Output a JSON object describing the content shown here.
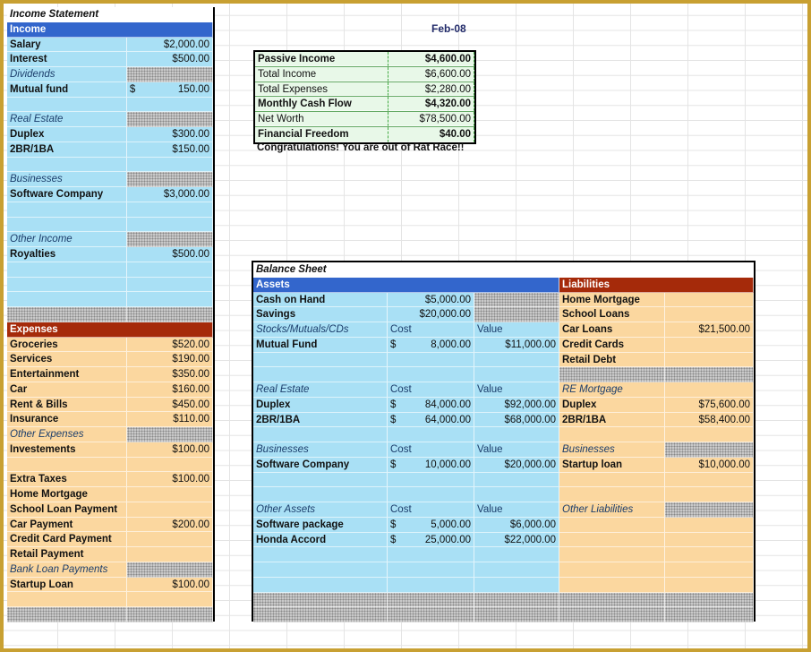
{
  "income_statement": {
    "title": "Income Statement",
    "income_header": "Income",
    "salary": {
      "label": "Salary",
      "value": "$2,000.00"
    },
    "interest": {
      "label": "Interest",
      "value": "$500.00"
    },
    "dividends_label": "Dividends",
    "mutual_fund": {
      "label": "Mutual fund",
      "currency": "$",
      "value": "150.00"
    },
    "real_estate_label": "Real Estate",
    "duplex": {
      "label": "Duplex",
      "value": "$300.00"
    },
    "br": {
      "label": "2BR/1BA",
      "value": "$150.00"
    },
    "businesses_label": "Businesses",
    "software_company": {
      "label": "Software Company",
      "value": "$3,000.00"
    },
    "other_income_label": "Other Income",
    "royalties": {
      "label": "Royalties",
      "value": "$500.00"
    },
    "expenses_header": "Expenses",
    "groceries": {
      "label": "Groceries",
      "value": "$520.00"
    },
    "services": {
      "label": "Services",
      "value": "$190.00"
    },
    "entertainment": {
      "label": "Entertainment",
      "value": "$350.00"
    },
    "car": {
      "label": "Car",
      "value": "$160.00"
    },
    "rent": {
      "label": "Rent & Bills",
      "value": "$450.00"
    },
    "insurance": {
      "label": "Insurance",
      "value": "$110.00"
    },
    "other_expenses_label": "Other Expenses",
    "investements": {
      "label": "Investements",
      "value": "$100.00"
    },
    "extra_taxes": {
      "label": "Extra Taxes",
      "value": "$100.00"
    },
    "home_mortgage": {
      "label": "Home Mortgage",
      "value": ""
    },
    "school_loan": {
      "label": "School Loan Payment",
      "value": ""
    },
    "car_payment": {
      "label": "Car Payment",
      "value": "$200.00"
    },
    "credit_card": {
      "label": "Credit Card Payment",
      "value": ""
    },
    "retail": {
      "label": "Retail Payment",
      "value": ""
    },
    "bank_loan_label": "Bank Loan Payments",
    "startup_loan": {
      "label": "Startup Loan",
      "value": "$100.00"
    }
  },
  "month": "Feb-08",
  "summary": {
    "passive_income": {
      "label": "Passive Income",
      "value": "$4,600.00"
    },
    "total_income": {
      "label": "Total Income",
      "value": "$6,600.00"
    },
    "total_expenses": {
      "label": "Total Expenses",
      "value": "$2,280.00"
    },
    "monthly_cash_flow": {
      "label": "Monthly Cash Flow",
      "value": "$4,320.00"
    },
    "net_worth": {
      "label": "Net Worth",
      "value": "$78,500.00"
    },
    "financial_freedom": {
      "label": "Financial Freedom",
      "value": "$40.00"
    }
  },
  "congrats": "Congratulations! You are out of Rat Race!!",
  "balance_sheet": {
    "title": "Balance Sheet",
    "assets_header": "Assets",
    "liabilities_header": "Liabilities",
    "cost_label": "Cost",
    "value_label": "Value",
    "cash_on_hand": {
      "label": "Cash on Hand",
      "value": "$5,000.00"
    },
    "savings": {
      "label": "Savings",
      "value": "$20,000.00"
    },
    "stocks_label": "Stocks/Mutuals/CDs",
    "mutual_fund": {
      "label": "Mutual Fund",
      "currency": "$",
      "cost": "8,000.00",
      "value": "$11,000.00"
    },
    "real_estate_label": "Real Estate",
    "duplex": {
      "label": "Duplex",
      "currency": "$",
      "cost": "84,000.00",
      "value": "$92,000.00"
    },
    "br": {
      "label": "2BR/1BA",
      "currency": "$",
      "cost": "64,000.00",
      "value": "$68,000.00"
    },
    "businesses_label": "Businesses",
    "software_company": {
      "label": "Software Company",
      "currency": "$",
      "cost": "10,000.00",
      "value": "$20,000.00"
    },
    "other_assets_label": "Other Assets",
    "software_package": {
      "label": "Software package",
      "currency": "$",
      "cost": "5,000.00",
      "value": "$6,000.00"
    },
    "honda": {
      "label": "Honda Accord",
      "currency": "$",
      "cost": "25,000.00",
      "value": "$22,000.00"
    },
    "liabilities": {
      "home_mortgage": {
        "label": "Home Mortgage",
        "value": ""
      },
      "school_loans": {
        "label": "School Loans",
        "value": ""
      },
      "car_loans": {
        "label": "Car Loans",
        "value": "$21,500.00"
      },
      "credit_cards": {
        "label": "Credit Cards",
        "value": ""
      },
      "retail_debt": {
        "label": "Retail Debt",
        "value": ""
      },
      "re_mortgage_label": "RE Mortgage",
      "duplex": {
        "label": "Duplex",
        "value": "$75,600.00"
      },
      "br": {
        "label": "2BR/1BA",
        "value": "$58,400.00"
      },
      "businesses_label": "Businesses",
      "startup_loan": {
        "label": "Startup loan",
        "value": "$10,000.00"
      },
      "other_label": "Other Liabilities"
    }
  }
}
